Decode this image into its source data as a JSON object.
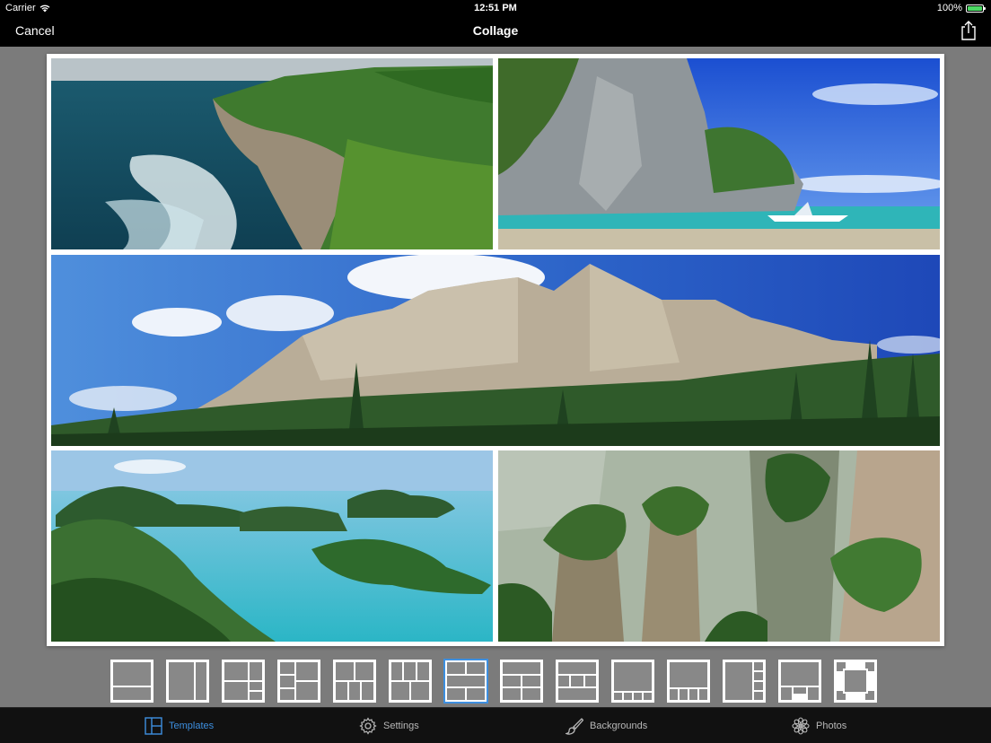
{
  "status_bar": {
    "carrier": "Carrier",
    "time": "12:51 PM",
    "battery": "100%",
    "battery_level": 1.0
  },
  "nav": {
    "cancel_label": "Cancel",
    "title": "Collage",
    "share_icon": "share-icon"
  },
  "collage": {
    "photos": [
      {
        "subject": "coastal cliffs with surf"
      },
      {
        "subject": "limestone rock over lagoon with boat"
      },
      {
        "subject": "mountain range with pine forest"
      },
      {
        "subject": "tropical islands in turquoise sea"
      },
      {
        "subject": "karst pillars with trees"
      }
    ]
  },
  "templates": {
    "selected_index": 6,
    "count": 14
  },
  "tabs": [
    {
      "label": "Templates",
      "icon": "templates-icon",
      "active": true
    },
    {
      "label": "Settings",
      "icon": "gear-icon",
      "active": false
    },
    {
      "label": "Backgrounds",
      "icon": "brush-icon",
      "active": false
    },
    {
      "label": "Photos",
      "icon": "flower-icon",
      "active": false
    }
  ],
  "colors": {
    "accent": "#3d8fe0",
    "battery": "#4cd964",
    "canvas_bg": "#7b7b7b"
  }
}
